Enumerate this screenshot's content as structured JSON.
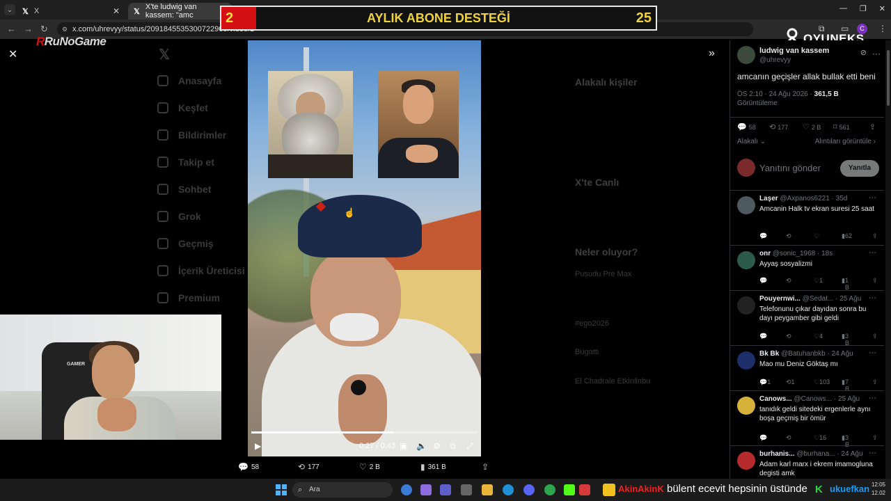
{
  "browser": {
    "tabs": [
      {
        "label": "X"
      },
      {
        "label": "X'te ludwig van kassem: \"amc"
      }
    ],
    "url": "x.com/uhrevyy/status/2091845535300722909/video/1"
  },
  "banner": {
    "left_number": "2",
    "title": "AYLIK ABONE DESTEĞİ",
    "right_number": "25"
  },
  "logos": {
    "runo": "RuNoGame",
    "oyuneks": "OYUNEKS"
  },
  "background_page": {
    "nav": [
      "Anasayfa",
      "Keşfet",
      "Bildirimler",
      "Takip et",
      "Sohbet",
      "Grok",
      "Geçmiş",
      "İçerik Üreticisi S",
      "Premium"
    ],
    "right_headers": [
      "Alakalı kişiler",
      "X'te Canlı",
      "Neler oluyor?"
    ],
    "trends": [
      "Pusudu Pre Max",
      "#ego2026",
      "Bugatti",
      "El Chadrale Etkinlinbu"
    ]
  },
  "video": {
    "elapsed": "0:27",
    "duration": "0:43",
    "timecode": "0:27 / 0:43",
    "progress": 0.628
  },
  "video_actions": {
    "replies": "58",
    "reposts": "177",
    "likes": "2 B",
    "views": "361 B"
  },
  "tweet": {
    "author_name": "ludwig van kassem",
    "author_handle": "@uhrevyy",
    "text": "amcanın geçişler allak bullak etti beni",
    "time": "ÖS 2:10 · 24 Ağu 2026 · ",
    "views_count": "361,5 B",
    "views_label": "Görüntüleme",
    "stats": {
      "replies": "58",
      "reposts": "177",
      "likes": "2 B",
      "bookmarks": "561"
    },
    "relevance": "Alakalı",
    "quotes_link": "Alıntıları görüntüle",
    "reply_placeholder": "Yanıtını gönder",
    "reply_button": "Yanıtla"
  },
  "replies": [
    {
      "name": "Laşer",
      "meta": "@Axpanos6221 · 35d",
      "text": "Amcanin Halk tv ekran suresi  25 saat",
      "reposts": "",
      "likes": "",
      "views": "62"
    },
    {
      "name": "onr",
      "meta": "@sonic_1968 · 18s",
      "text": "Ayyaş sosyalizmi",
      "reposts": "",
      "likes": "1",
      "views": "1 B"
    },
    {
      "name": "Pouyernwi...",
      "meta": "@Sedat... · 25 Ağu",
      "text": "Telefonunu çıkar dayıdan sonra bu dayı peygamber gibi geldi",
      "reposts": "",
      "likes": "4",
      "views": "3 B"
    },
    {
      "name": "Bk Bk",
      "meta": "@Batuhanbkb · 24 Ağu",
      "text": "Mao mu Deniz Göktaş mı",
      "replies": "1",
      "reposts": "1",
      "likes": "103",
      "views": "7 B"
    },
    {
      "name": "Canows...",
      "meta": "@Canows... · 25 Ağu",
      "text": "tanıdık geldi sitedeki ergenlerle aynı boşa geçmiş bir ömür",
      "reposts": "",
      "likes": "16",
      "views": "3 B"
    },
    {
      "name": "burhanis...",
      "meta": "@burhana... · 24 Ağu",
      "text": "Adam karl marx i ekrem imamogluna degisti amk",
      "reposts": "",
      "likes": "",
      "views": ""
    }
  ],
  "taskbar": {
    "search_placeholder": "Ara",
    "ticker_user": "AkinAkinK",
    "ticker_message": "bülent ecevit hepsinin üstünde",
    "ticker_user2": "ukuefkan",
    "clock_time": "12:05",
    "clock_date": "12.02"
  },
  "colors": {
    "banner_red": "#d40f14",
    "banner_gold": "#f0d33a",
    "x_bg": "#000000",
    "muted": "#71767b"
  }
}
